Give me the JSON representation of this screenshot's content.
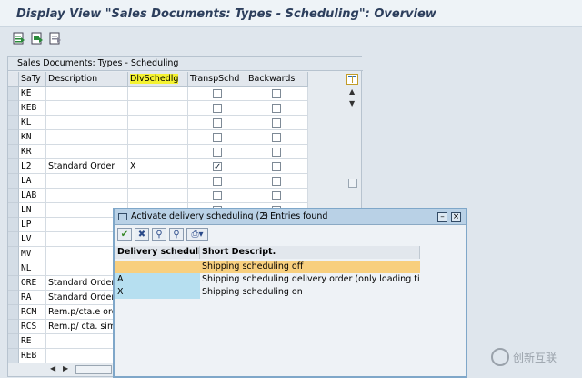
{
  "window": {
    "title": "Display View \"Sales Documents: Types - Scheduling\": Overview"
  },
  "toolbar": {
    "buttons": [
      "select-all-icon",
      "select-block-icon",
      "deselect-all-icon"
    ]
  },
  "table": {
    "caption": "Sales Documents: Types - Scheduling",
    "columns": [
      "SaTy",
      "Description",
      "DlvSchedlg",
      "TranspSchd",
      "Backwards"
    ],
    "rows": [
      {
        "saty": "KE",
        "description": "",
        "dlvschedlg": "",
        "transp": false,
        "backwards": false
      },
      {
        "saty": "KEB",
        "description": "",
        "dlvschedlg": "",
        "transp": false,
        "backwards": false
      },
      {
        "saty": "KL",
        "description": "",
        "dlvschedlg": "",
        "transp": false,
        "backwards": false
      },
      {
        "saty": "KN",
        "description": "",
        "dlvschedlg": "",
        "transp": false,
        "backwards": false
      },
      {
        "saty": "KR",
        "description": "",
        "dlvschedlg": "",
        "transp": false,
        "backwards": false
      },
      {
        "saty": "L2",
        "description": "Standard Order",
        "dlvschedlg": "X",
        "transp": true,
        "backwards": false
      },
      {
        "saty": "LA",
        "description": "",
        "dlvschedlg": "",
        "transp": false,
        "backwards": false
      },
      {
        "saty": "LAB",
        "description": "",
        "dlvschedlg": "",
        "transp": false,
        "backwards": false
      },
      {
        "saty": "LN",
        "description": "",
        "dlvschedlg": "",
        "transp": false,
        "backwards": false
      },
      {
        "saty": "LP",
        "description": "",
        "dlvschedlg": "",
        "transp": false,
        "backwards": false
      },
      {
        "saty": "LV",
        "description": "",
        "dlvschedlg": "",
        "transp": false,
        "backwards": false
      },
      {
        "saty": "MV",
        "description": "",
        "dlvschedlg": "",
        "transp": false,
        "backwards": false
      },
      {
        "saty": "NL",
        "description": "",
        "dlvschedlg": "",
        "transp": false,
        "backwards": false
      },
      {
        "saty": "ORE",
        "description": "Standard Order E",
        "dlvschedlg": "",
        "transp": false,
        "backwards": false
      },
      {
        "saty": "RA",
        "description": "Standard Order",
        "dlvschedlg": "",
        "transp": false,
        "backwards": false
      },
      {
        "saty": "RCM",
        "description": "Rem.p/cta.e ord.",
        "dlvschedlg": "",
        "transp": false,
        "backwards": false
      },
      {
        "saty": "RCS",
        "description": "Rem.p/ cta. simp",
        "dlvschedlg": "",
        "transp": false,
        "backwards": false
      },
      {
        "saty": "RE",
        "description": "",
        "dlvschedlg": "",
        "transp": false,
        "backwards": false
      },
      {
        "saty": "REB",
        "description": "",
        "dlvschedlg": "",
        "transp": false,
        "backwards": false
      }
    ]
  },
  "popup": {
    "title": "Activate delivery scheduling (2)",
    "count": "3 Entries found",
    "toolbar_icons": [
      "checkmark-icon",
      "close-icon",
      "find-icon",
      "find-next-icon",
      "print-icon"
    ],
    "columns": [
      "Delivery scheduling",
      "Short Descript."
    ],
    "entries": [
      {
        "key": "",
        "text": "Shipping scheduling off"
      },
      {
        "key": "A",
        "text": "Shipping scheduling delivery order (only loading time) on"
      },
      {
        "key": "X",
        "text": "Shipping scheduling on"
      }
    ]
  },
  "watermark": {
    "text": "创新互联"
  },
  "colors": {
    "highlight": "#f4f232",
    "popup_selected": "#f8cf7e",
    "popup_key": "#b6dff0"
  }
}
